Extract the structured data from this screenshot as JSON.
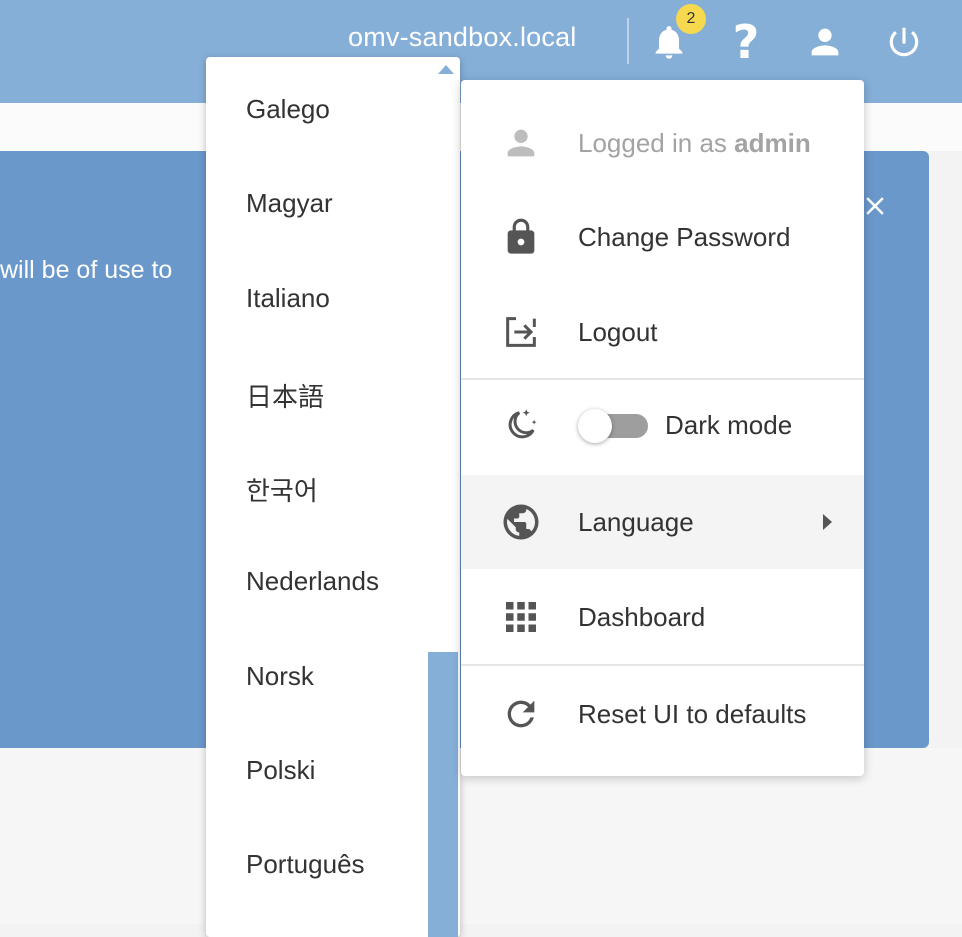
{
  "toolbar": {
    "hostname": "omv-sandbox.local",
    "notification_count": "2",
    "help_glyph": "?",
    "icons": [
      "bell-icon",
      "help-icon",
      "user-icon",
      "power-icon"
    ]
  },
  "alert": {
    "text_fragment": "will be of use to"
  },
  "language_menu": {
    "items": [
      "Galego",
      "Magyar",
      "Italiano",
      "日本語",
      "한국어",
      "Nederlands",
      "Norsk",
      "Polski",
      "Português"
    ]
  },
  "user_menu": {
    "logged_in_prefix": "Logged in as ",
    "logged_in_user": "admin",
    "change_password": "Change Password",
    "logout": "Logout",
    "dark_mode": "Dark mode",
    "dark_mode_enabled": false,
    "language": "Language",
    "dashboard": "Dashboard",
    "reset_ui": "Reset UI to defaults"
  },
  "colors": {
    "toolbar": "#86afd8",
    "alert": "#6a98cb",
    "badge": "#f6d94e"
  }
}
